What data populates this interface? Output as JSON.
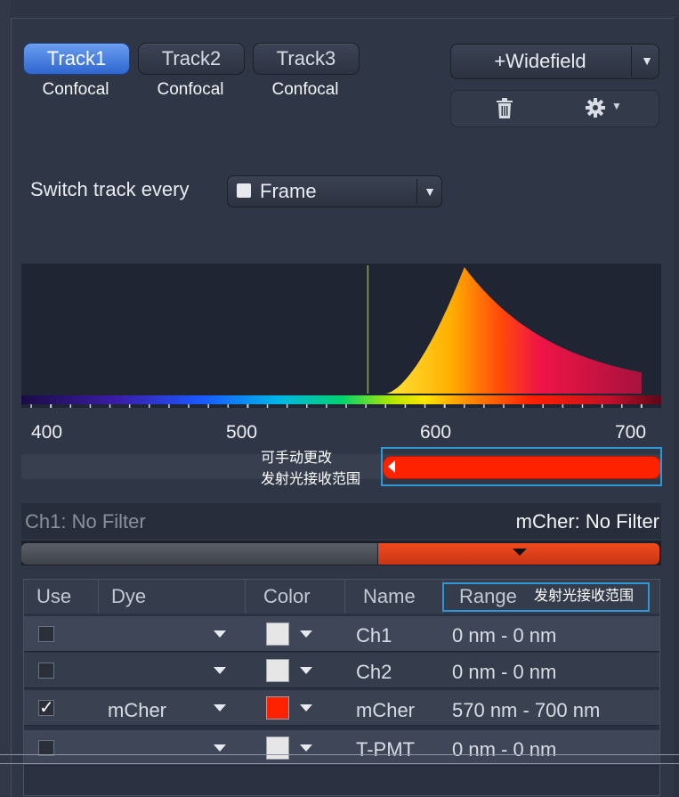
{
  "tracks": [
    {
      "label": "Track1",
      "mode": "Confocal",
      "active": true
    },
    {
      "label": "Track2",
      "mode": "Confocal",
      "active": false
    },
    {
      "label": "Track3",
      "mode": "Confocal",
      "active": false
    }
  ],
  "widefield": {
    "label": "+Widefield",
    "arrow": "▼"
  },
  "toolbar": {
    "delete_icon": "trash-icon",
    "settings_icon": "gear-icon",
    "settings_caret": "▼"
  },
  "switch_track": {
    "label": "Switch track every",
    "value": "Frame",
    "arrow": "▼"
  },
  "spectrum": {
    "axis_ticks": [
      "400",
      "500",
      "600",
      "700"
    ],
    "axis_range_nm": [
      385,
      710
    ],
    "laser_line_nm": 561,
    "emission_peak_nm": 610,
    "detection_range_nm": [
      570,
      700
    ]
  },
  "annotations": {
    "slider_note_line1": "可手动更改",
    "slider_note_line2": "发射光接收范围",
    "header_note": "发射光接收范围"
  },
  "filters": {
    "left": "Ch1: No Filter",
    "right": "mCher: No Filter"
  },
  "table": {
    "headers": {
      "use": "Use",
      "dye": "Dye",
      "color": "Color",
      "name": "Name",
      "range": "Range"
    },
    "rows": [
      {
        "use": "",
        "dye": "",
        "color": "#e6e6e6",
        "name": "Ch1",
        "range": "0 nm - 0 nm"
      },
      {
        "use": "",
        "dye": "",
        "color": "#e6e6e6",
        "name": "Ch2",
        "range": "0 nm - 0 nm"
      },
      {
        "use": "✓",
        "dye": "mCher",
        "color": "#ff2200",
        "name": "mCher",
        "range": "570 nm - 700 nm"
      },
      {
        "use": "",
        "dye": "",
        "color": "#e6e6e6",
        "name": "T-PMT",
        "range": "0 nm - 0 nm"
      }
    ]
  },
  "colors": {
    "accent_blue": "#4a86e8",
    "detection_red": "#ff2200"
  }
}
